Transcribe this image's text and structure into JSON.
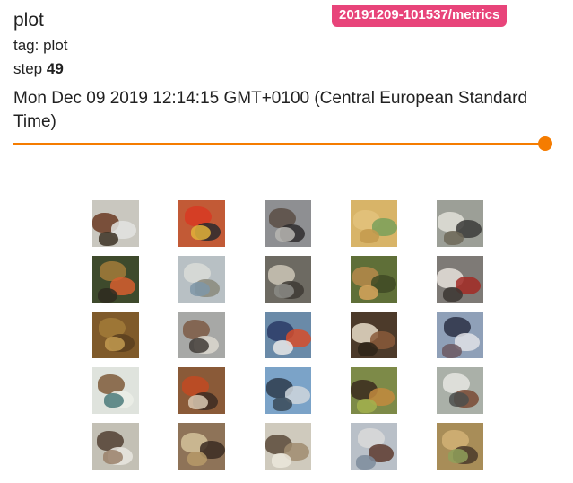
{
  "card": {
    "title": "plot",
    "run": "20191209-101537/metrics",
    "tag_label": "tag:",
    "tag_value": "plot",
    "step_label": "step",
    "step_value": "49",
    "timestamp": "Mon Dec 09 2019 12:14:15 GMT+0100 (Central European Standard Time)"
  },
  "colors": {
    "badge": "#e8447a",
    "slider": "#f57c00"
  },
  "slider": {
    "value_fraction": 1.0
  },
  "image_grid": {
    "rows": 5,
    "cols": 5,
    "tiles": [
      {
        "bg": "#c9c7bf",
        "blobs": [
          "#6b3a22",
          "#e3e3e0",
          "#3d3324"
        ]
      },
      {
        "bg": "#c25a36",
        "blobs": [
          "#d83a22",
          "#2a2a2e",
          "#e2b23a"
        ]
      },
      {
        "bg": "#8e8f92",
        "blobs": [
          "#5b4e44",
          "#2f2d2e",
          "#b7b6b1"
        ]
      },
      {
        "bg": "#d8b468",
        "blobs": [
          "#e3c27c",
          "#7aa05a",
          "#c49a4e"
        ]
      },
      {
        "bg": "#9c9f97",
        "blobs": [
          "#e2e0d8",
          "#3b3b38",
          "#6f6858"
        ]
      },
      {
        "bg": "#3e4a2c",
        "blobs": [
          "#a37b3a",
          "#d65e2f",
          "#2e2a20"
        ]
      },
      {
        "bg": "#b8c0c4",
        "blobs": [
          "#d9dcd8",
          "#8a8a7c",
          "#7e97a8"
        ]
      },
      {
        "bg": "#6d6a62",
        "blobs": [
          "#ccc6b7",
          "#3e3a35",
          "#8b8b86"
        ]
      },
      {
        "bg": "#5f6f38",
        "blobs": [
          "#b6894a",
          "#3f4a24",
          "#d7a55c"
        ]
      },
      {
        "bg": "#7e7a76",
        "blobs": [
          "#e6e2dc",
          "#a22a25",
          "#3b3633"
        ]
      },
      {
        "bg": "#7f5a2a",
        "blobs": [
          "#a27b38",
          "#5a3f1f",
          "#c29a50"
        ]
      },
      {
        "bg": "#a7a8a6",
        "blobs": [
          "#7c5a44",
          "#dcd8cf",
          "#413c37"
        ]
      },
      {
        "bg": "#6a8aa8",
        "blobs": [
          "#2a3a66",
          "#d64c2a",
          "#e8e8e8"
        ]
      },
      {
        "bg": "#4c3a2a",
        "blobs": [
          "#e8ddc8",
          "#8a5a3a",
          "#2e2418"
        ]
      },
      {
        "bg": "#8fa0b8",
        "blobs": [
          "#2c3044",
          "#e1e2e6",
          "#6c5860"
        ]
      },
      {
        "bg": "#dfe3dd",
        "blobs": [
          "#7f5a3a",
          "#eceee8",
          "#4b7a7a"
        ]
      },
      {
        "bg": "#8a5a38",
        "blobs": [
          "#c24a22",
          "#3c2c22",
          "#d9c8b2"
        ]
      },
      {
        "bg": "#7ba3c8",
        "blobs": [
          "#2e3c4c",
          "#cfd6dc",
          "#3a4a58"
        ]
      },
      {
        "bg": "#7d8a48",
        "blobs": [
          "#3a2a1e",
          "#c28a3e",
          "#a2b04e"
        ]
      },
      {
        "bg": "#aab0a8",
        "blobs": [
          "#e6e6e2",
          "#7a4a34",
          "#4c4f4c"
        ]
      },
      {
        "bg": "#c3c0b5",
        "blobs": [
          "#523f33",
          "#e9e6e0",
          "#9a806a"
        ]
      },
      {
        "bg": "#8e7358",
        "blobs": [
          "#d3c29a",
          "#3b2c22",
          "#b79a68"
        ]
      },
      {
        "bg": "#cfcabd",
        "blobs": [
          "#5b4a3a",
          "#a08c70",
          "#ebe7dc"
        ]
      },
      {
        "bg": "#b9c0c8",
        "blobs": [
          "#d9d9d9",
          "#5d3a2e",
          "#7c8c9c"
        ]
      },
      {
        "bg": "#a88d58",
        "blobs": [
          "#d2b276",
          "#4a3a2a",
          "#8fa05a"
        ]
      }
    ]
  }
}
